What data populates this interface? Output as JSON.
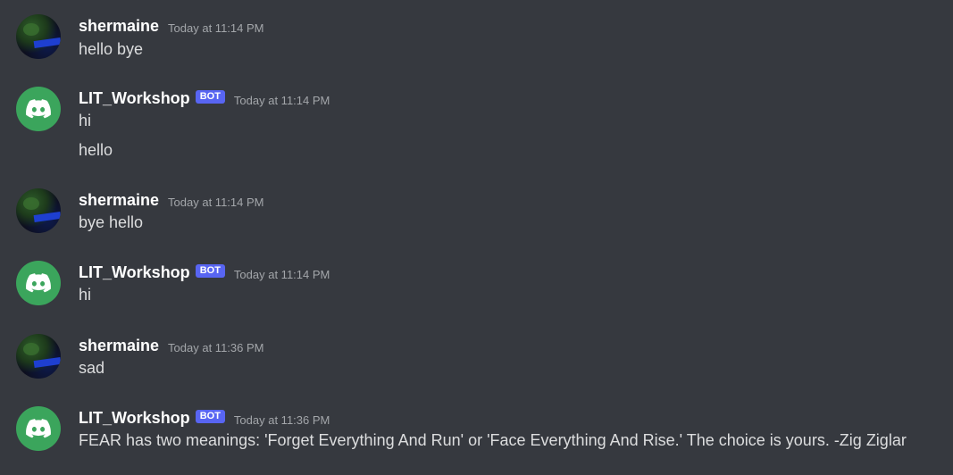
{
  "messages": [
    {
      "author": "shermaine",
      "bot_tag": "",
      "timestamp": "Today at 11:14 PM",
      "lines": [
        "hello bye"
      ]
    },
    {
      "author": "LIT_Workshop",
      "bot_tag": "BOT",
      "timestamp": "Today at 11:14 PM",
      "lines": [
        "hi",
        "hello"
      ]
    },
    {
      "author": "shermaine",
      "bot_tag": "",
      "timestamp": "Today at 11:14 PM",
      "lines": [
        "bye hello"
      ]
    },
    {
      "author": "LIT_Workshop",
      "bot_tag": "BOT",
      "timestamp": "Today at 11:14 PM",
      "lines": [
        "hi"
      ]
    },
    {
      "author": "shermaine",
      "bot_tag": "",
      "timestamp": "Today at 11:36 PM",
      "lines": [
        "sad"
      ]
    },
    {
      "author": "LIT_Workshop",
      "bot_tag": "BOT",
      "timestamp": "Today at 11:36 PM",
      "lines": [
        "FEAR has two meanings: 'Forget Everything And Run' or 'Face Everything And Rise.' The choice is yours. -Zig Ziglar"
      ]
    }
  ],
  "icons": {
    "user_avatar": "user-avatar-image",
    "bot_avatar": "discord-logo-icon"
  },
  "colors": {
    "background": "#36393f",
    "bot_tag": "#5865f2",
    "bot_avatar": "#3ba55c",
    "timestamp": "#a3a6aa"
  }
}
